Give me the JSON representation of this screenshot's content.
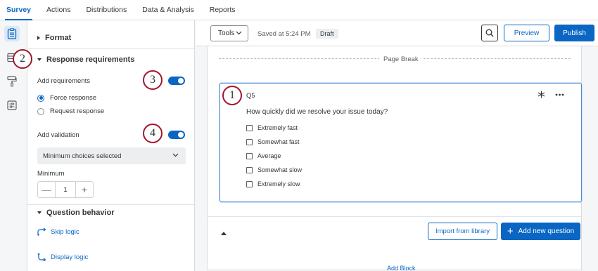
{
  "topnav": {
    "tabs": [
      {
        "label": "Survey",
        "active": true
      },
      {
        "label": "Actions"
      },
      {
        "label": "Distributions"
      },
      {
        "label": "Data & Analysis"
      },
      {
        "label": "Reports"
      }
    ]
  },
  "rail": {
    "icons": [
      "survey-icon",
      "block-icon",
      "paint-roller-icon",
      "sliders-icon"
    ]
  },
  "panel": {
    "format_label": "Format",
    "response_requirements": {
      "title": "Response requirements",
      "add_requirements_label": "Add requirements",
      "add_requirements_on": true,
      "options": [
        {
          "label": "Force response",
          "checked": true
        },
        {
          "label": "Request response",
          "checked": false
        }
      ],
      "add_validation_label": "Add validation",
      "add_validation_on": true,
      "validation_select": "Minimum choices selected",
      "minimum_label": "Minimum",
      "minimum_value": "1",
      "minus": "—",
      "plus": "+"
    },
    "question_behavior": {
      "title": "Question behavior",
      "skip_logic": "Skip logic",
      "display_logic": "Display logic"
    }
  },
  "callouts": [
    "1",
    "2",
    "3",
    "4"
  ],
  "toolbar": {
    "tools_label": "Tools",
    "saved_text": "Saved at 5:24 PM",
    "draft_badge": "Draft",
    "preview_label": "Preview",
    "publish_label": "Publish"
  },
  "block": {
    "page_break_label": "Page Break",
    "question": {
      "id": "Q5",
      "text": "How quickly did we resolve your issue today?",
      "choices": [
        "Extremely fast",
        "Somewhat fast",
        "Average",
        "Somewhat slow",
        "Extremely slow"
      ]
    },
    "import_label": "Import from library",
    "add_question_label": "Add new question",
    "add_question_plus": "+",
    "add_block_label": "Add Block"
  },
  "colors": {
    "accent": "#0a66c2",
    "callout_border": "#a3162c"
  }
}
